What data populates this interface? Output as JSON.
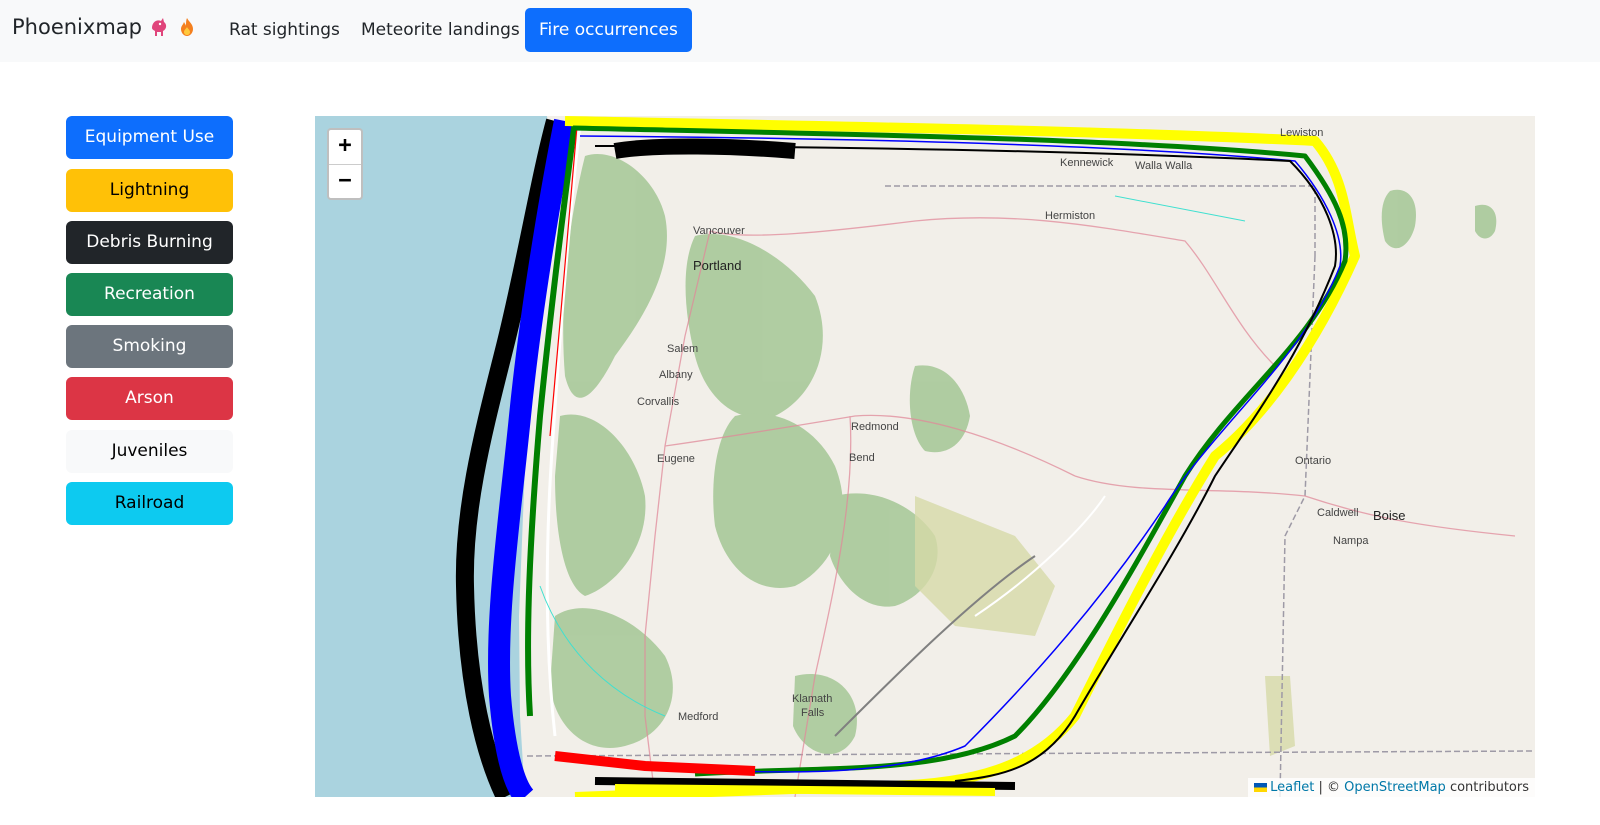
{
  "navbar": {
    "brand": "Phoenixmap",
    "brand_icons": [
      "phoenix-bird-icon",
      "fire-icon"
    ],
    "links": [
      {
        "label": "Rat sightings",
        "active": false
      },
      {
        "label": "Meteorite landings",
        "active": false
      },
      {
        "label": "Fire occurrences",
        "active": true
      }
    ]
  },
  "sidebar": {
    "buttons": [
      {
        "label": "Equipment Use",
        "bg": "#0d6efd",
        "fg": "#ffffff"
      },
      {
        "label": "Lightning",
        "bg": "#ffc107",
        "fg": "#000000"
      },
      {
        "label": "Debris Burning",
        "bg": "#212529",
        "fg": "#ffffff"
      },
      {
        "label": "Recreation",
        "bg": "#198754",
        "fg": "#ffffff"
      },
      {
        "label": "Smoking",
        "bg": "#6c757d",
        "fg": "#ffffff"
      },
      {
        "label": "Arson",
        "bg": "#dc3545",
        "fg": "#ffffff"
      },
      {
        "label": "Juveniles",
        "bg": "#f8f9fa",
        "fg": "#000000"
      },
      {
        "label": "Railroad",
        "bg": "#0dcaf0",
        "fg": "#000000"
      }
    ]
  },
  "map": {
    "zoom_in": "+",
    "zoom_out": "−",
    "places": {
      "lewiston": "Lewiston",
      "kennewick": "Kennewick",
      "walla_walla": "Walla Walla",
      "hermiston": "Hermiston",
      "vancouver": "Vancouver",
      "portland": "Portland",
      "salem": "Salem",
      "albany": "Albany",
      "corvallis": "Corvallis",
      "redmond": "Redmond",
      "bend": "Bend",
      "eugene": "Eugene",
      "ontario": "Ontario",
      "caldwell": "Caldwell",
      "boise": "Boise",
      "nampa": "Nampa",
      "klamath": "Klamath",
      "falls": "Falls",
      "medford": "Medford"
    },
    "attribution": {
      "leaflet": "Leaflet",
      "sep": " | © ",
      "osm": "OpenStreetMap",
      "suffix": " contributors"
    },
    "outline_colors": [
      "#0000ff",
      "#ffff00",
      "#000000",
      "#008000",
      "#808080",
      "#ff0000",
      "#ffffff",
      "#40e0d0"
    ]
  }
}
